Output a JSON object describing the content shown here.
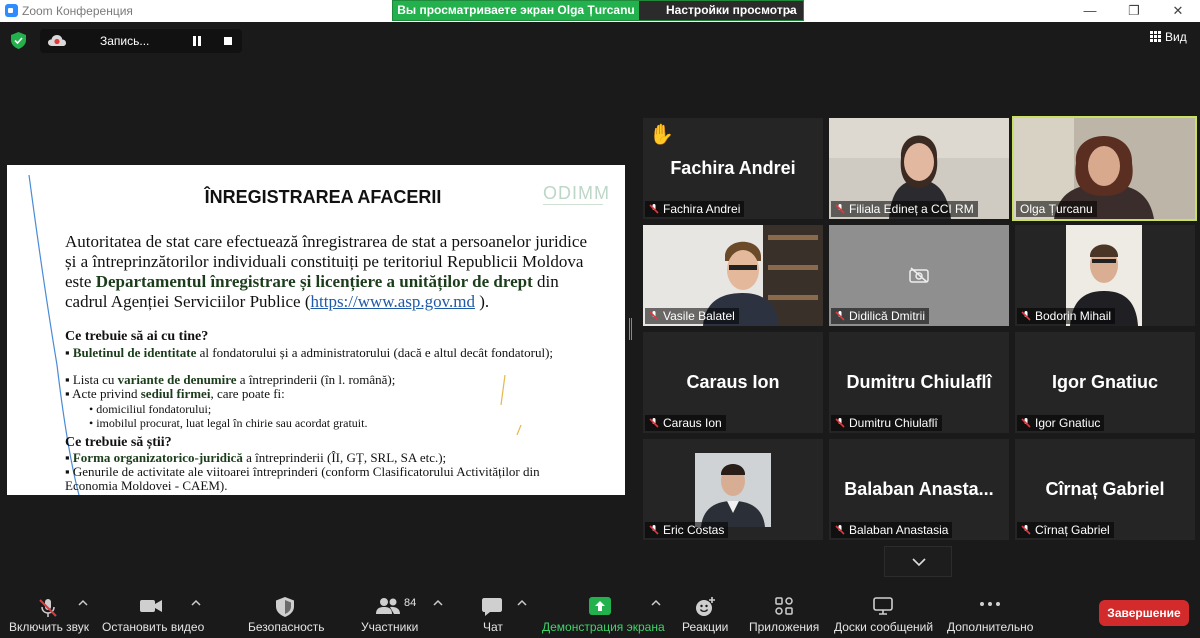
{
  "window": {
    "title": "Zoom Конференция",
    "minimize": "—",
    "restore": "❐",
    "close": "✕"
  },
  "share_banner": {
    "viewing": "Вы просматриваете экран Olga Țurcanu",
    "settings": "Настройки просмотра"
  },
  "recording": {
    "label": "Запись..."
  },
  "view": {
    "label": "Вид"
  },
  "slide": {
    "title": "ÎNREGISTRAREA AFACERII",
    "logo": "ODIMM",
    "intro_part1": "Autoritatea de stat  care efectuează înregistrarea de stat a persoanelor juridice și a întreprinzătorilor individuali constituiți pe teritoriul Republicii Moldova este ",
    "intro_bold": "Departamentul înregistrare și licențiere a unităților de drept",
    "intro_part2": " din cadrul Agenției Serviciilor Publice (",
    "intro_link": "https://www.asp.gov.md",
    "intro_end": " ).",
    "section1": "Ce trebuie să ai cu tine?",
    "b1_bold": "Buletinul de identitate",
    "b1_rest": " al fondatorului și a administratorului (dacă e altul decât fondatorul);",
    "b2_pre": "Lista cu ",
    "b2_bold": "variante de denumire",
    "b2_rest": " a întreprinderii (în l. română);",
    "b3_pre": "Acte privind ",
    "b3_bold": "sediul firmei",
    "b3_rest": ", care poate fi:",
    "s1": "domiciliul fondatorului;",
    "s2": "imobilul procurat, luat legal în chirie sau acordat gratuit.",
    "section2": "Ce trebuie să știi?",
    "b4_bold": "Forma organizatorico-juridică",
    "b4_rest": " a întreprinderii (ÎI, GȚ, SRL, SA etc.);",
    "b5": "Genurile de activitate ale viitoarei întreprinderi (conform Clasificatorului Activităților din Economia Moldovei - CAEM)."
  },
  "participants": [
    {
      "display": "Fachira Andrei",
      "name": "Fachira Andrei",
      "video": false,
      "hand": "✋"
    },
    {
      "display": "",
      "name": "Filiala Edineț a CCI RM",
      "video": true
    },
    {
      "display": "",
      "name": "Olga Țurcanu",
      "video": true,
      "active": true
    },
    {
      "display": "",
      "name": "Vasile Balatel",
      "video": true
    },
    {
      "display": "",
      "name": "Didilică Dmitrii",
      "video": false
    },
    {
      "display": "",
      "name": "Bodorin Mihail",
      "video": true
    },
    {
      "display": "Caraus Ion",
      "name": "Caraus Ion",
      "video": false
    },
    {
      "display": "Dumitru Chiulaflî",
      "name": "Dumitru Chiulaflî",
      "video": false
    },
    {
      "display": "Igor Gnatiuc",
      "name": "Igor Gnatiuc",
      "video": false
    },
    {
      "display": "",
      "name": "Eric Costas",
      "video": true
    },
    {
      "display": "Balaban  Anasta...",
      "name": "Balaban Anastasia",
      "video": false
    },
    {
      "display": "Cîrnaț Gabriel",
      "name": "Cîrnaț Gabriel",
      "video": false
    }
  ],
  "toolbar": {
    "unmute": "Включить звук",
    "stop_video": "Остановить видео",
    "security": "Безопасность",
    "participants": "Участники",
    "participants_count": "84",
    "chat": "Чат",
    "share_screen": "Демонстрация экрана",
    "reactions": "Реакции",
    "apps": "Приложения",
    "whiteboards": "Доски сообщений",
    "more": "Дополнительно",
    "end": "Завершение"
  },
  "colors": {
    "share_green": "#23b14d",
    "active_speaker": "#c8e063",
    "end_red": "#d32b2b",
    "muted_red": "#e0383e"
  }
}
